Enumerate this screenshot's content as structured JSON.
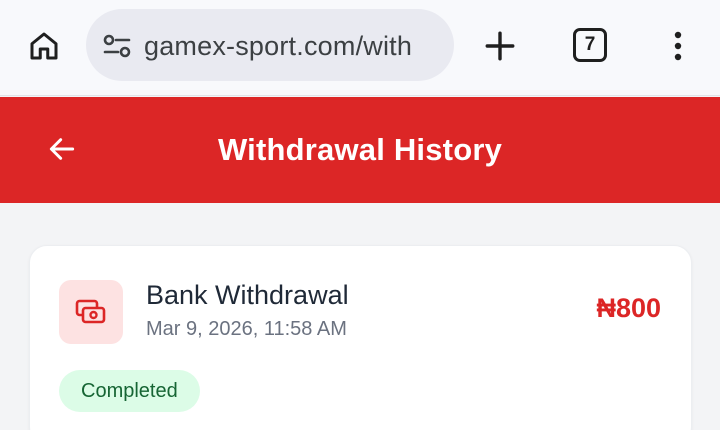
{
  "browser": {
    "url": "gamex-sport.com/with",
    "tab_count": "7"
  },
  "header": {
    "title": "Withdrawal History"
  },
  "transactions": [
    {
      "title": "Bank Withdrawal",
      "date": "Mar 9, 2026, 11:58 AM",
      "amount": "₦800",
      "status": "Completed",
      "icon": "cash-icon"
    }
  ],
  "colors": {
    "accent": "#dc2626",
    "status_completed_bg": "#dcfce7",
    "status_completed_text": "#166534",
    "icon_bg": "#fde2e2"
  }
}
